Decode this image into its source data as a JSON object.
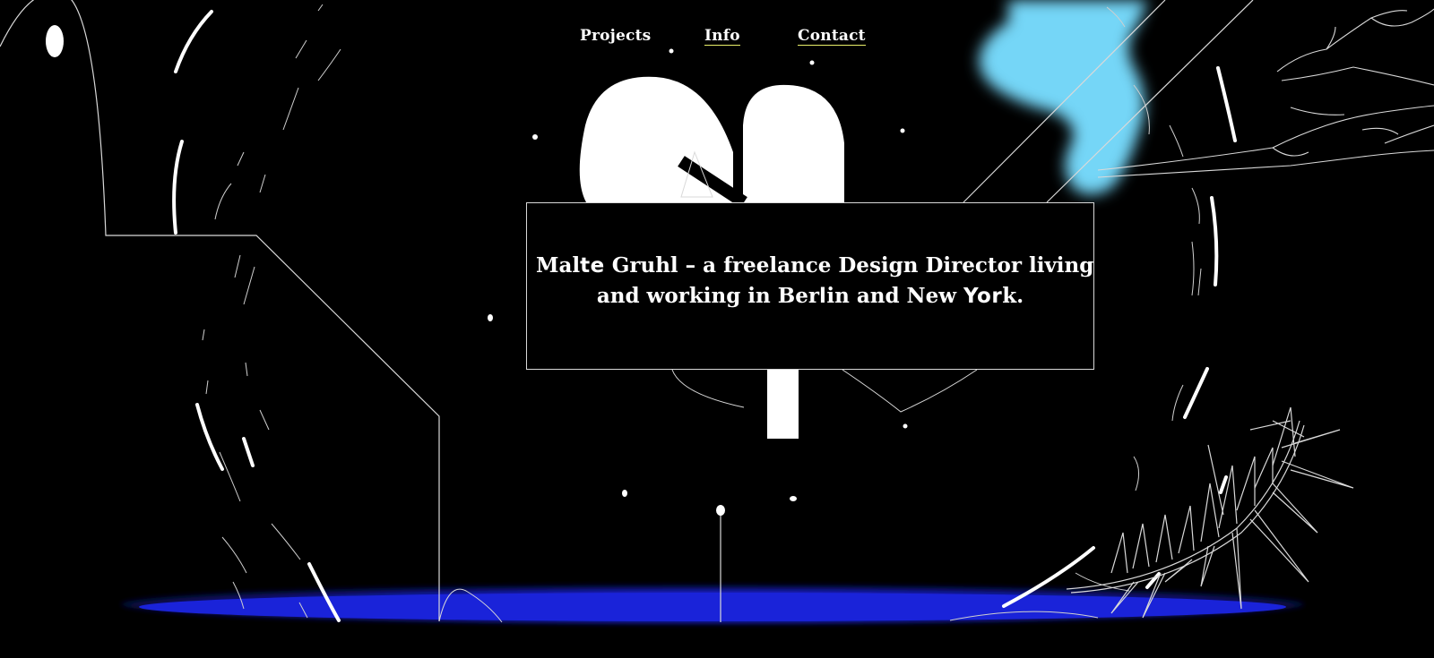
{
  "nav": {
    "items": [
      {
        "label": "Projects",
        "underlined": false
      },
      {
        "label": "Info",
        "underlined": true
      },
      {
        "label": "Contact",
        "underlined": true
      }
    ],
    "underline_color": "#e9f06a"
  },
  "intro": {
    "line1_a": "Mal",
    "line1_b": "te",
    "line1_c": " Gruhl – a freelance Design Director living",
    "line2_a": "and working in Ber",
    "line2_b": "l",
    "line2_c": "in and New ",
    "line2_d": "Yor",
    "line2_e": "k."
  },
  "colors": {
    "background": "#000000",
    "blob": "#75d6f7",
    "portal": "#1a23d9",
    "stroke": "#d9d9d9",
    "text": "#ffffff"
  }
}
